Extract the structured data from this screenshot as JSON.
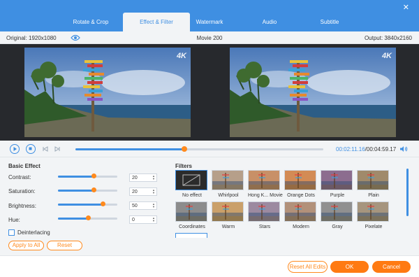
{
  "tabs": [
    {
      "label": "Rotate & Crop"
    },
    {
      "label": "Effect & Filter"
    },
    {
      "label": "Watermark"
    },
    {
      "label": "Audio"
    },
    {
      "label": "Subtitle"
    }
  ],
  "active_tab": "Effect & Filter",
  "info": {
    "original": "Original: 1920x1080",
    "title": "Movie 200",
    "output": "Output: 3840x2160"
  },
  "preview": {
    "badge": "4K"
  },
  "player": {
    "current_time": "00:02:11.16",
    "separator": "/",
    "total_time": "00:04:59.17",
    "progress_fraction": 0.44
  },
  "basic_effect": {
    "title": "Basic Effect",
    "rows": [
      {
        "label": "Contrast:",
        "value": "20",
        "level": 0.6
      },
      {
        "label": "Saturation:",
        "value": "20",
        "level": 0.6
      },
      {
        "label": "Brightness:",
        "value": "50",
        "level": 0.75
      },
      {
        "label": "Hue:",
        "value": "0",
        "level": 0.5
      }
    ],
    "deinterlacing_label": "Deinterlacing",
    "apply_label": "Apply to All",
    "reset_label": "Reset"
  },
  "filters": {
    "title": "Filters",
    "items": [
      {
        "name": "No effect",
        "selected": true
      },
      {
        "name": "Whirlpool"
      },
      {
        "name": "Hong K... Movie"
      },
      {
        "name": "Orange Dots"
      },
      {
        "name": "Purple"
      },
      {
        "name": "Plain"
      },
      {
        "name": "Coordinates"
      },
      {
        "name": "Warm"
      },
      {
        "name": "Stars"
      },
      {
        "name": "Modern"
      },
      {
        "name": "Gray"
      },
      {
        "name": "Pixelate"
      }
    ]
  },
  "footer": {
    "reset_all": "Reset All Edits",
    "ok": "OK",
    "cancel": "Cancel"
  },
  "colors": {
    "accent": "#3f8fe2",
    "orange": "#ff8a1e"
  }
}
